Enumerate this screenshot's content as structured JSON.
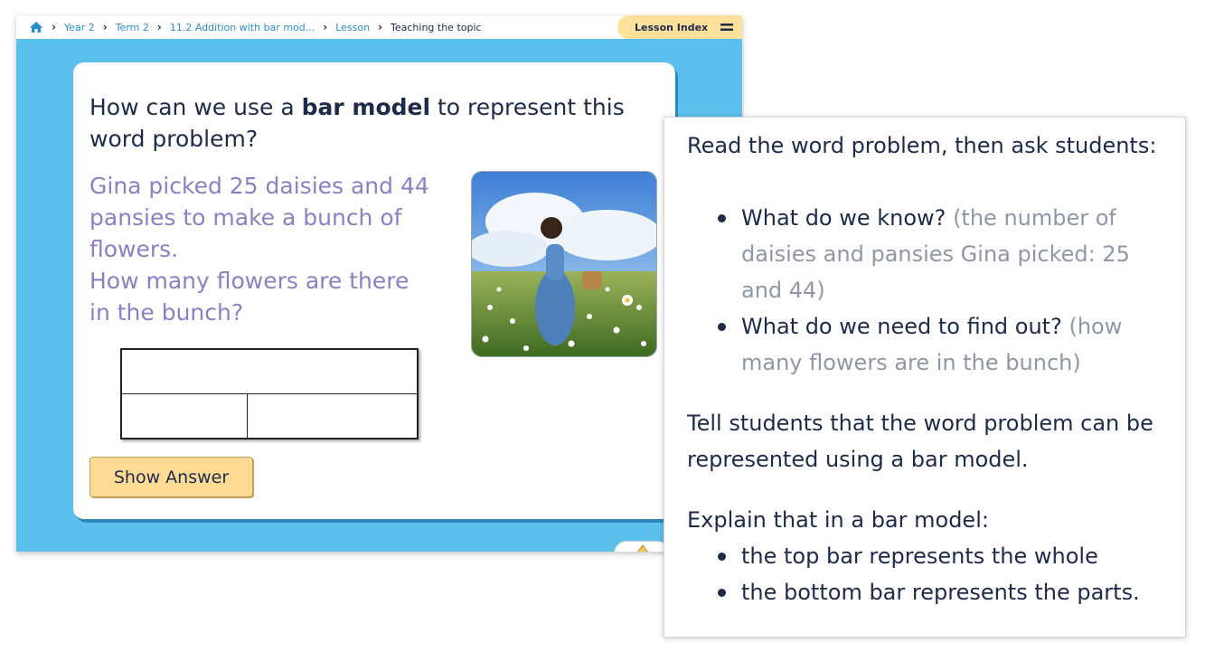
{
  "breadcrumb": {
    "home_icon": "home-icon",
    "items": [
      "Year 2",
      "Term 2",
      "11.2 Addition with bar mod...",
      "Lesson"
    ],
    "current": "Teaching the topic"
  },
  "lesson_index": {
    "label": "Lesson Index",
    "icon": "menu-icon"
  },
  "slide": {
    "question_pre": "How can we use a ",
    "question_bold": "bar model",
    "question_post": " to represent this word problem?",
    "problem_line1": "Gina picked 25 daisies and 44 pansies to make a bunch of flowers.",
    "problem_line2": "How many flowers are there in the bunch?",
    "show_answer": "Show Answer"
  },
  "notes": {
    "intro": "Read the word problem, then ask students:",
    "questions": [
      {
        "q": "What do we know?",
        "hint": "(the number of daisies and pansies Gina picked: 25 and 44)"
      },
      {
        "q": "What do we need to find out?",
        "hint": "(how many flowers are in the bunch)"
      }
    ],
    "tell": "Tell students that the word problem can be represented using a bar model.",
    "explain": "Explain that in a bar model:",
    "points": [
      "the top bar represents the whole",
      "the bottom bar represents the parts."
    ]
  },
  "colors": {
    "background": "#5bc0ec",
    "heading": "#1d2a4a",
    "problem_text": "#8c7fc4",
    "hint_text": "#8f96a6",
    "button": "#fddb94",
    "link": "#2a8fc7"
  }
}
